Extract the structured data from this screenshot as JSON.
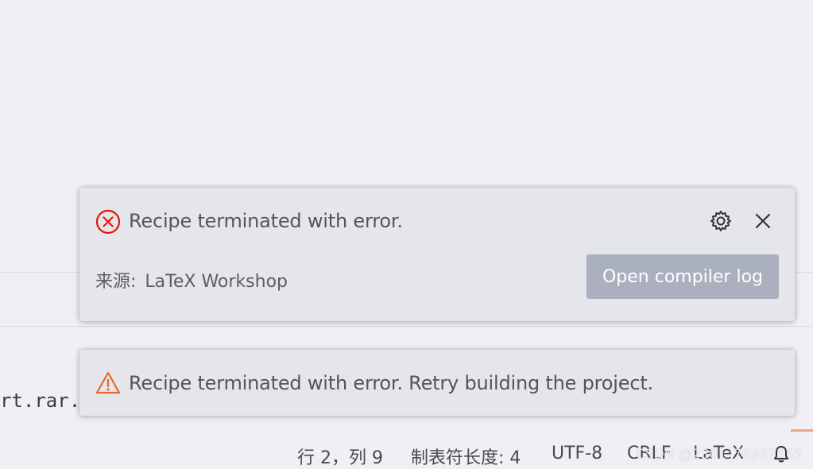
{
  "notifications": [
    {
      "severity": "error",
      "icon": "error-circle-icon",
      "message": "Recipe terminated with error.",
      "source_label": "来源:",
      "source_name": "LaTeX Workshop",
      "action_label": "Open compiler log",
      "settings_icon": "gear-icon",
      "close_icon": "close-icon"
    },
    {
      "severity": "warning",
      "icon": "warning-triangle-icon",
      "message": "Recipe terminated with error. Retry building the project."
    }
  ],
  "editor": {
    "partial_code_text": "rt.rar."
  },
  "status_bar": {
    "line_col": "行 2，列 9",
    "tab_size": "制表符长度: 4",
    "encoding": "UTF-8",
    "eol": "CRLF",
    "language": "LaTeX",
    "watermark": "CSDN @2301_79967665",
    "notification_icon": "bell-icon"
  },
  "colors": {
    "background": "#eef0f6",
    "toast_background": "#e4e6ec",
    "error": "#e51400",
    "warning": "#e6692d",
    "button": "#aab0bd"
  }
}
